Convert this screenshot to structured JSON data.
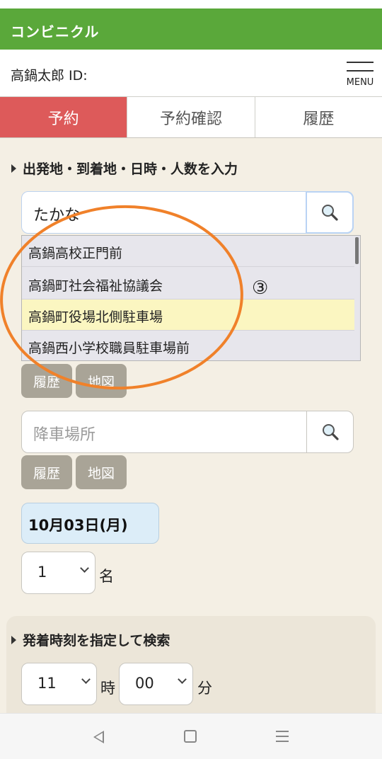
{
  "app": {
    "title": "コンビニクル"
  },
  "user": {
    "label": "高鍋太郎 ID:",
    "menu_label": "MENU"
  },
  "tabs": [
    {
      "label": "予約"
    },
    {
      "label": "予約確認"
    },
    {
      "label": "履歴"
    }
  ],
  "section1": {
    "title": "出発地・到着地・日時・人数を入力"
  },
  "departure": {
    "value": "たかな",
    "suggestions": [
      "高鍋高校正門前",
      "高鍋町社会福祉協議会",
      "高鍋町役場北側駐車場",
      "高鍋西小学校職員駐車場前"
    ],
    "history_label": "履歴",
    "map_label": "地図"
  },
  "arrival": {
    "placeholder": "降車場所",
    "history_label": "履歴",
    "map_label": "地図"
  },
  "date": {
    "value": "10月03日(月)"
  },
  "people": {
    "value": "1",
    "unit": "名"
  },
  "section2": {
    "title": "発着時刻を指定して検索"
  },
  "time": {
    "hour": "11",
    "hour_unit": "時",
    "minute": "00",
    "minute_unit": "分"
  },
  "annotation": {
    "label": "③",
    "color": "#f0812a"
  },
  "colors": {
    "brand": "#5aa83a",
    "active_tab": "#dd5a5a",
    "highlight": "#fbf6c1"
  }
}
